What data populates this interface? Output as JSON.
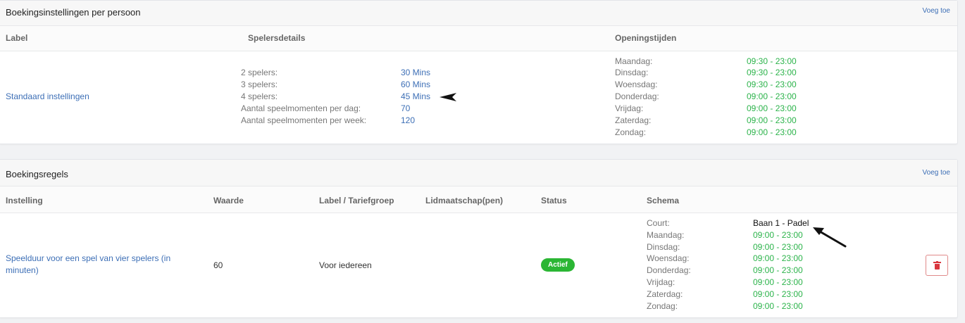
{
  "settings": {
    "title": "Boekingsinstellingen per persoon",
    "add_label": "Voeg toe",
    "columns": {
      "label": "Label",
      "players": "Spelersdetails",
      "hours": "Openingstijden"
    },
    "row": {
      "label": "Standaard instellingen",
      "players": [
        {
          "key": "2 spelers:",
          "value": "30 Mins"
        },
        {
          "key": "3 spelers:",
          "value": "60 Mins"
        },
        {
          "key": "4 spelers:",
          "value": "45 Mins"
        },
        {
          "key": "Aantal speelmomenten per dag:",
          "value": "70"
        },
        {
          "key": "Aantal speelmomenten per week:",
          "value": "120"
        }
      ],
      "hours": [
        {
          "day": "Maandag:",
          "time": "09:30 - 23:00"
        },
        {
          "day": "Dinsdag:",
          "time": "09:30 - 23:00"
        },
        {
          "day": "Woensdag:",
          "time": "09:30 - 23:00"
        },
        {
          "day": "Donderdag:",
          "time": "09:00 - 23:00"
        },
        {
          "day": "Vrijdag:",
          "time": "09:00 - 23:00"
        },
        {
          "day": "Zaterdag:",
          "time": "09:00 - 23:00"
        },
        {
          "day": "Zondag:",
          "time": "09:00 - 23:00"
        }
      ]
    }
  },
  "rules": {
    "title": "Boekingsregels",
    "add_label": "Voeg toe",
    "columns": {
      "setting": "Instelling",
      "value": "Waarde",
      "label_group": "Label / Tariefgroep",
      "membership": "Lidmaatschap(pen)",
      "status": "Status",
      "schedule": "Schema"
    },
    "row": {
      "setting_line1": "Speelduur voor een spel van vier spelers (in",
      "setting_line2": "minuten)",
      "value": "60",
      "label_group": "Voor iedereen",
      "membership": "",
      "status": "Actief",
      "court_key": "Court:",
      "court_value": "Baan 1 - Padel",
      "schedule": [
        {
          "day": "Maandag:",
          "time": "09:00 - 23:00"
        },
        {
          "day": "Dinsdag:",
          "time": "09:00 - 23:00"
        },
        {
          "day": "Woensdag:",
          "time": "09:00 - 23:00"
        },
        {
          "day": "Donderdag:",
          "time": "09:00 - 23:00"
        },
        {
          "day": "Vrijdag:",
          "time": "09:00 - 23:00"
        },
        {
          "day": "Zaterdag:",
          "time": "09:00 - 23:00"
        },
        {
          "day": "Zondag:",
          "time": "09:00 - 23:00"
        }
      ],
      "delete_icon": "trash-icon"
    }
  },
  "colors": {
    "link": "#3d6fb6",
    "time_green": "#2bb34a",
    "badge_green": "#2bb634",
    "delete_red": "#d9363e"
  }
}
